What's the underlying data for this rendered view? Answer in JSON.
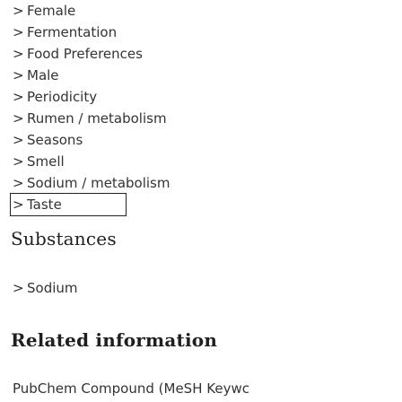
{
  "terms": [
    {
      "label": "Female"
    },
    {
      "label": "Fermentation"
    },
    {
      "label": "Food Preferences"
    },
    {
      "label": "Male"
    },
    {
      "label": "Periodicity"
    },
    {
      "label": "Rumen / metabolism"
    },
    {
      "label": "Seasons"
    },
    {
      "label": "Smell"
    },
    {
      "label": "Sodium / metabolism"
    },
    {
      "label": "Taste"
    }
  ],
  "chevron": ">",
  "substances": {
    "title": "Substances",
    "items": [
      {
        "label": "Sodium"
      }
    ]
  },
  "related": {
    "title": "Related information",
    "link": "PubChem Compound (MeSH Keywc"
  }
}
